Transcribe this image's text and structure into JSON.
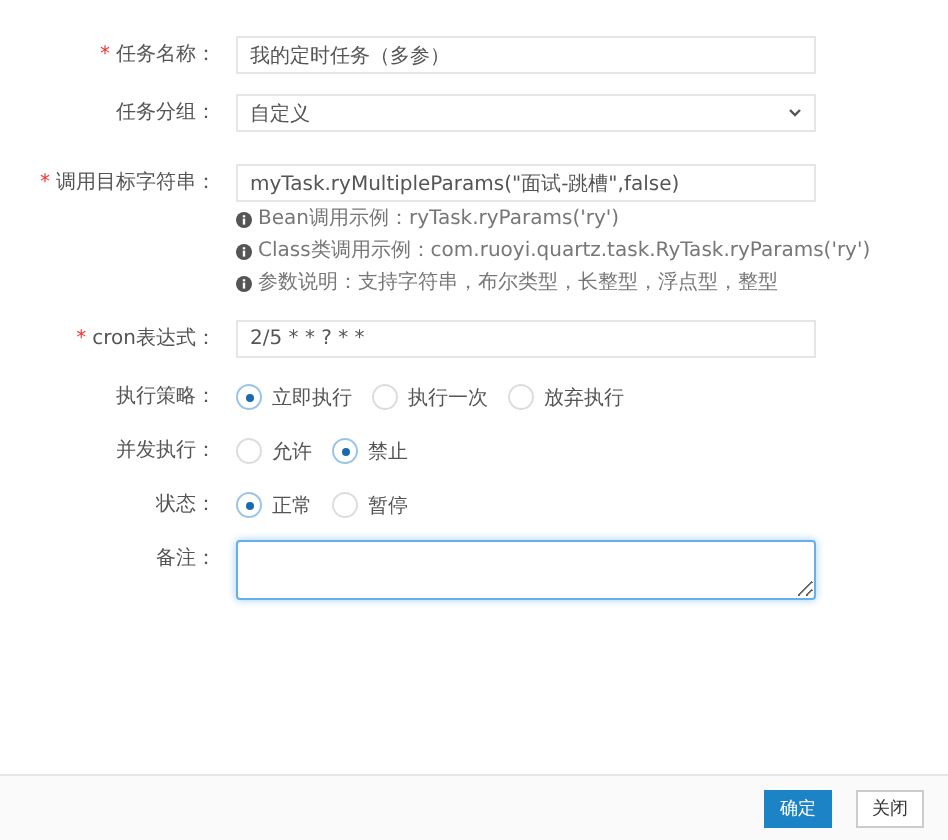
{
  "form": {
    "fields": [
      {
        "kind": "text",
        "label": "任务名称：",
        "required_mark": "*",
        "value": "我的定时任务（多参）"
      },
      {
        "kind": "select",
        "label": "任务分组：",
        "value": "自定义"
      },
      {
        "kind": "text",
        "label": "调用目标字符串：",
        "required_mark": "*",
        "value": "myTask.ryMultipleParams(\"面试-跳槽\",false)",
        "hints": [
          "Bean调用示例：ryTask.ryParams('ry')",
          "Class类调用示例：com.ruoyi.quartz.task.RyTask.ryParams('ry')",
          "参数说明：支持字符串，布尔类型，长整型，浮点型，整型"
        ]
      },
      {
        "kind": "text",
        "label": "cron表达式：",
        "required_mark": "*",
        "value": "2/5 * * ? * *"
      },
      {
        "kind": "radio",
        "label": "执行策略：",
        "options": [
          {
            "label": "立即执行",
            "selected": true
          },
          {
            "label": "执行一次",
            "selected": false
          },
          {
            "label": "放弃执行",
            "selected": false
          }
        ]
      },
      {
        "kind": "radio",
        "label": "并发执行：",
        "options": [
          {
            "label": "允许",
            "selected": false
          },
          {
            "label": "禁止",
            "selected": true
          }
        ]
      },
      {
        "kind": "radio",
        "label": "状态：",
        "options": [
          {
            "label": "正常",
            "selected": true
          },
          {
            "label": "暂停",
            "selected": false
          }
        ]
      },
      {
        "kind": "textarea",
        "label": "备注：",
        "focused": true
      }
    ]
  },
  "footer": {
    "buttons": [
      {
        "label": "确定",
        "kind": "primary"
      },
      {
        "label": "关闭",
        "kind": "default"
      }
    ]
  }
}
